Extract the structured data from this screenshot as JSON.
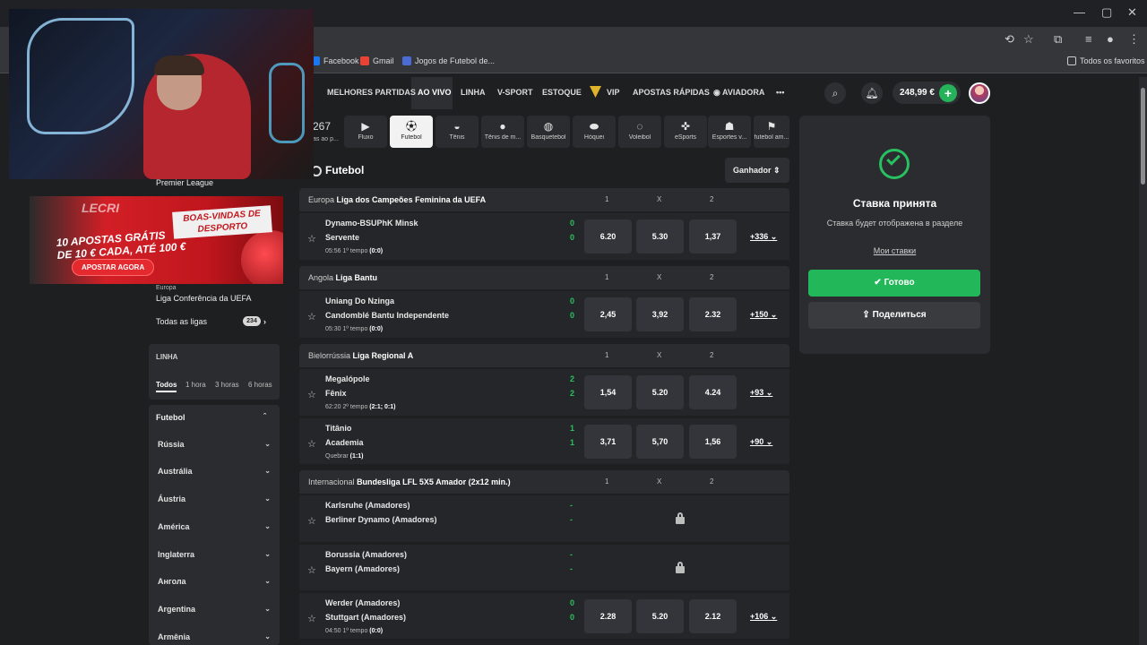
{
  "browser": {
    "bookmarks": [
      "Facebook",
      "Gmail",
      "Jogos de Futebol de...",
      "Todos os favoritos"
    ]
  },
  "promo": {
    "brand": "LECRI",
    "welcome": "BOAS-VINDAS DE DESPORTO",
    "offer_line1": "10 APOSTAS GRÁTIS",
    "offer_line2": "DE 10 € CADA, ATÉ 100 €",
    "cta": "APOSTAR AGORA"
  },
  "header": {
    "nav": [
      "MELHORES PARTIDAS",
      "AO VIVO",
      "LINHA",
      "V-SPORT",
      "ESTOQUE",
      "VIP",
      "APOSTAS RÁPIDAS",
      "AVIADORA",
      "•••"
    ],
    "balance": "248,99 €",
    "plus": "+"
  },
  "sport_tabs": {
    "count": "267",
    "count_label": "as ao p...",
    "items": [
      "Fluxo",
      "Futebol",
      "Tênis",
      "Tênis de m...",
      "Basquetebol",
      "Hóquei",
      "Voleibol",
      "eSports",
      "Esportes v...",
      "futebol am..."
    ]
  },
  "sidebar": {
    "premier": "Premier League",
    "europa_region": "Europa",
    "conf_league": "Liga Conferência da UEFA",
    "all_leagues": "Todas as ligas",
    "all_count": "234",
    "linha_title": "LINHA",
    "filters": [
      "Todos",
      "1 hora",
      "3 horas",
      "6 horas"
    ],
    "sport_title": "Futebol",
    "countries": [
      "Rússia",
      "Austrália",
      "Áustria",
      "América",
      "Inglaterra",
      "Ангола",
      "Argentina",
      "Armênia"
    ]
  },
  "main": {
    "title": "Futebol",
    "sort": "Ganhador",
    "cols": [
      "1",
      "X",
      "2"
    ],
    "leagues": [
      {
        "region": "Europa",
        "name": "Liga dos Campeões Feminina da UEFA"
      },
      {
        "region": "Angola",
        "name": "Liga Bantu"
      },
      {
        "region": "Bielorrússia",
        "name": "Liga Regional A"
      },
      {
        "region": "Internacional",
        "name": "Bundesliga LFL 5X5 Amador (2x12 min.)"
      }
    ],
    "matches": [
      {
        "t1": "Dynamo-BSUPhK Minsk",
        "t2": "Servente",
        "s1": "0",
        "s2": "0",
        "time": "05:56",
        "period": "1º tempo",
        "score": "(0:0)",
        "o1": "6.20",
        "ox": "5.30",
        "o2": "1,37",
        "more": "+336"
      },
      {
        "t1": "Uniang Do Nzinga",
        "t2": "Candomblé Bantu Independente",
        "s1": "0",
        "s2": "0",
        "time": "05:30",
        "period": "1º tempo",
        "score": "(0:0)",
        "o1": "2,45",
        "ox": "3,92",
        "o2": "2.32",
        "more": "+150"
      },
      {
        "t1": "Megalópole",
        "t2": "Fênix",
        "s1": "2",
        "s2": "2",
        "time": "62:20",
        "period": "2º tempo",
        "score": "(2:1; 0:1)",
        "o1": "1,54",
        "ox": "5.20",
        "o2": "4.24",
        "more": "+93"
      },
      {
        "t1": "Titânio",
        "t2": "Academia",
        "s1": "1",
        "s2": "1",
        "time": "",
        "period": "Quebrar",
        "score": "(1:1)",
        "o1": "3,71",
        "ox": "5,70",
        "o2": "1,56",
        "more": "+90"
      },
      {
        "t1": "Karlsruhe (Amadores)",
        "t2": "Berliner Dynamo (Amadores)",
        "s1": "-",
        "s2": "-"
      },
      {
        "t1": "Borussia (Amadores)",
        "t2": "Bayern (Amadores)",
        "s1": "-",
        "s2": "-"
      },
      {
        "t1": "Werder (Amadores)",
        "t2": "Stuttgart (Amadores)",
        "s1": "0",
        "s2": "0",
        "time": "04:50",
        "period": "1º tempo",
        "score": "(0:0)",
        "o1": "2.28",
        "ox": "5.20",
        "o2": "2.12",
        "more": "+106"
      }
    ]
  },
  "bet_panel": {
    "title": "Ставка принята",
    "subtitle": "Ставка будет отображена в разделе",
    "link": "Мои ставки",
    "done": "Готово",
    "share": "Поделиться"
  },
  "colors": {
    "accent": "#22b85a",
    "score": "#28c060"
  }
}
